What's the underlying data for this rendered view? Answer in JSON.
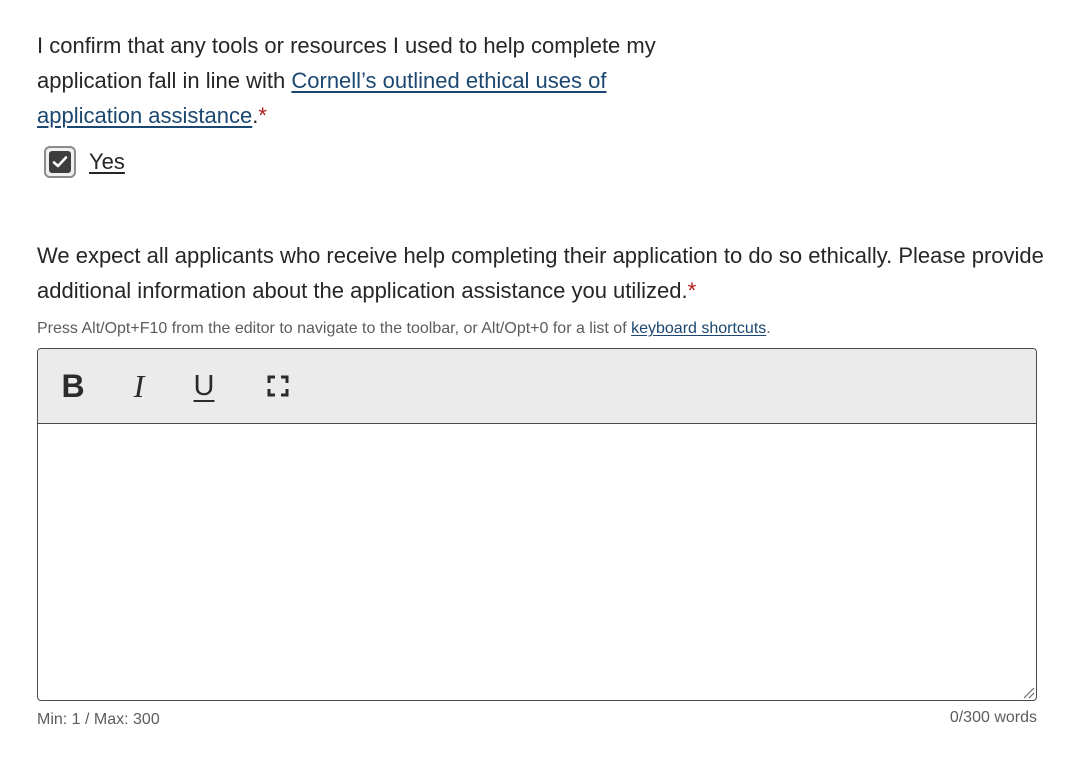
{
  "question1": {
    "text_before": "I confirm that any tools or resources I used to help complete my application fall in line with ",
    "link_text": "Cornell’s outlined ethical uses of application assistance",
    "text_after": ".",
    "required_mark": "*"
  },
  "checkbox": {
    "label": "Yes",
    "checked": true
  },
  "question2": {
    "text": "We expect all applicants who receive help completing their application to do so ethically. Please provide additional information about the application assistance you utilized.",
    "required_mark": "*"
  },
  "hint": {
    "text": "Press Alt/Opt+F10 from the editor to navigate to the toolbar, or Alt/Opt+0 for a list of ",
    "link_text": "keyboard shortcuts",
    "text_after": "."
  },
  "toolbar": {
    "bold": "B",
    "italic": "I",
    "underline": "U",
    "fullscreen_icon": "fullscreen-icon"
  },
  "editor": {
    "value": ""
  },
  "limits": {
    "min_max": "Min: 1 / Max: 300",
    "word_count": "0/300 words"
  },
  "colors": {
    "link": "#1b4770",
    "required": "#b31b1b",
    "toolbar_bg": "#ebebeb"
  }
}
